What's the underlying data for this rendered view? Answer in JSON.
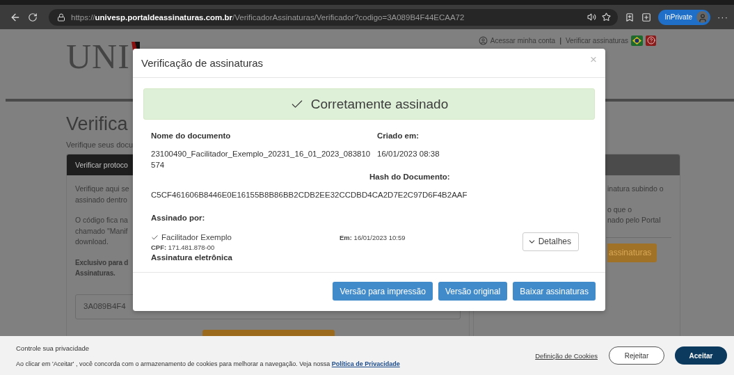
{
  "browser": {
    "url_scheme": "https://",
    "url_host": "univesp.portaldeassinaturas.com.br",
    "url_path": "/VerificadorAssinaturas/Verificador?codigo=3A089B4F44ECAA72",
    "profile": "InPrivate",
    "more": "···"
  },
  "header": {
    "logo": "UNI",
    "links": [
      "Acessar minha conta",
      "Verificar assinaturas"
    ],
    "separator": "|"
  },
  "page": {
    "title": "Verifica",
    "subtitle": "Verifique seus docu",
    "left_card": {
      "header": "Verificar protoco",
      "paragraphs": [
        [
          "Verifique aqui se",
          "assinado dentro"
        ],
        [
          "O código fica na",
          "chamado \"Manif",
          "download."
        ]
      ],
      "note": [
        "Exclusivo para d",
        "Assinaturas."
      ],
      "code_value": "3A089B4F4"
    },
    "right_card": {
      "paragraphs": [
        [
          "inatura subindo o"
        ],
        [
          "o que o",
          "nado pelo Portal"
        ]
      ],
      "button": "assinaturas"
    }
  },
  "modal": {
    "title": "Verificação de assinaturas",
    "close": "×",
    "status": "Corretamente assinado",
    "document_name_label": "Nome do documento",
    "document_name": "23100490_Facilitador_Exemplo_20231_16_01_2023_083810574",
    "created_label": "Criado em:",
    "created": "16/01/2023 08:38",
    "hash_label": "Hash do Documento:",
    "hash": "C5CF461606B8446E0E16155B8B86BB2CDB2EE32CCDBD4CA2D7E2C97D6F4B2AAF",
    "signed_by_label": "Assinado por:",
    "signers": [
      {
        "name": "Facilitador Exemplo",
        "cpf": "**CPF:** 171.481.878-00",
        "type": "Assinatura eletrônica",
        "date": "**Em:** 16/01/2023 10:59",
        "details": "Detalhes"
      }
    ],
    "buttons": [
      "Versão para impressão",
      "Versão original",
      "Baixar assinaturas"
    ]
  },
  "cookie_banner": {
    "title": "Controle sua privacidade",
    "text": "Ao clicar em 'Aceitar' , você concorda com o armazenamento de cookies para melhorar a navegação. Veja nossa",
    "policy_link": "Política de Privacidade",
    "settings_link": "Definição de Cookies",
    "reject": "Rejeitar",
    "accept": "Aceitar"
  }
}
